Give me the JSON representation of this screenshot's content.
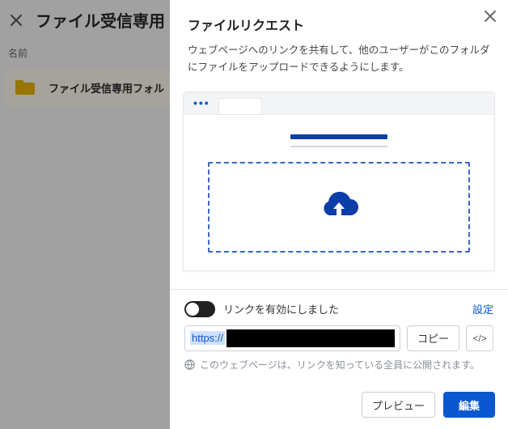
{
  "background": {
    "title": "ファイル受信専用",
    "column_header": "名前",
    "row_name": "ファイル受信専用フォル"
  },
  "panel": {
    "title": "ファイルリクエスト",
    "description": "ウェブページへのリンクを共有して、他のユーザーがこのフォルダにファイルをアップロードできるようにします。",
    "toggle_label": "リンクを有効にしました",
    "settings_label": "設定",
    "url_protocol": "https://",
    "copy_label": "コピー",
    "embed_label": "</>",
    "visibility_note": "このウェブページは、リンクを知っている全員に公開されます。",
    "preview_label": "プレビュー",
    "edit_label": "編集"
  }
}
